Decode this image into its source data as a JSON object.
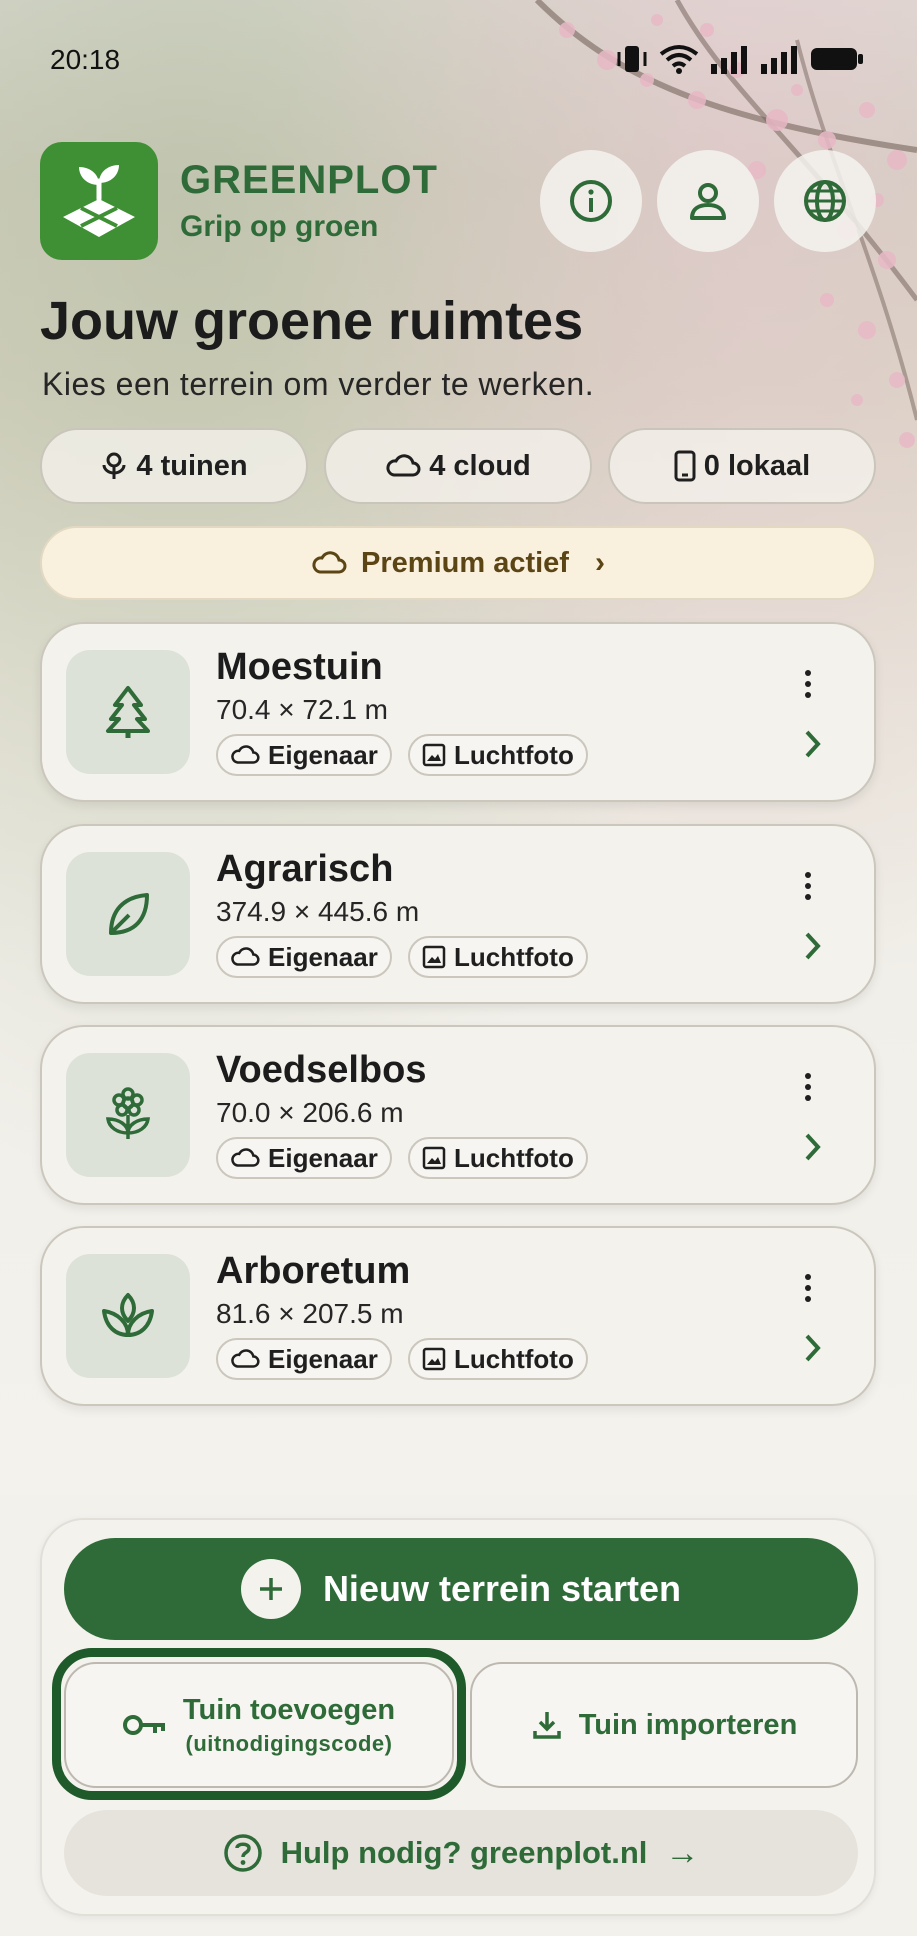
{
  "status_bar": {
    "time": "20:18"
  },
  "app": {
    "name": "GREENPLOT",
    "tagline": "Grip op groen"
  },
  "header_buttons": [
    {
      "icon": "info-icon"
    },
    {
      "icon": "account-icon"
    },
    {
      "icon": "globe-icon"
    }
  ],
  "page": {
    "title": "Jouw groene ruimtes",
    "subtitle": "Kies een terrein om verder te werken."
  },
  "stats": {
    "gardens": "4 tuinen",
    "cloud": "4 cloud",
    "local": "0 lokaal"
  },
  "premium": {
    "label": "Premium actief",
    "chevron": "›"
  },
  "terrains": [
    {
      "name": "Moestuin",
      "dims": "70.4 × 72.1 m",
      "icon": "tree-icon",
      "role": "Eigenaar",
      "layer": "Luchtfoto"
    },
    {
      "name": "Agrarisch",
      "dims": "374.9 × 445.6 m",
      "icon": "leaf-icon",
      "role": "Eigenaar",
      "layer": "Luchtfoto"
    },
    {
      "name": "Voedselbos",
      "dims": "70.0 × 206.6 m",
      "icon": "flower-icon",
      "role": "Eigenaar",
      "layer": "Luchtfoto"
    },
    {
      "name": "Arboretum",
      "dims": "81.6 × 207.5 m",
      "icon": "sprout-icon",
      "role": "Eigenaar",
      "layer": "Luchtfoto"
    }
  ],
  "actions": {
    "new_terrain": "Nieuw terrein starten",
    "add_garden": "Tuin toevoegen",
    "add_garden_sub": "(uitnodigingscode)",
    "import_garden": "Tuin importeren",
    "help": "Hulp nodig? greenplot.nl",
    "help_arrow": "→"
  },
  "colors": {
    "brand_green": "#2e6b38",
    "logo_green": "#3f8f35",
    "premium_bg": "#f9f1de",
    "icon_tile": "#dde2d8"
  }
}
